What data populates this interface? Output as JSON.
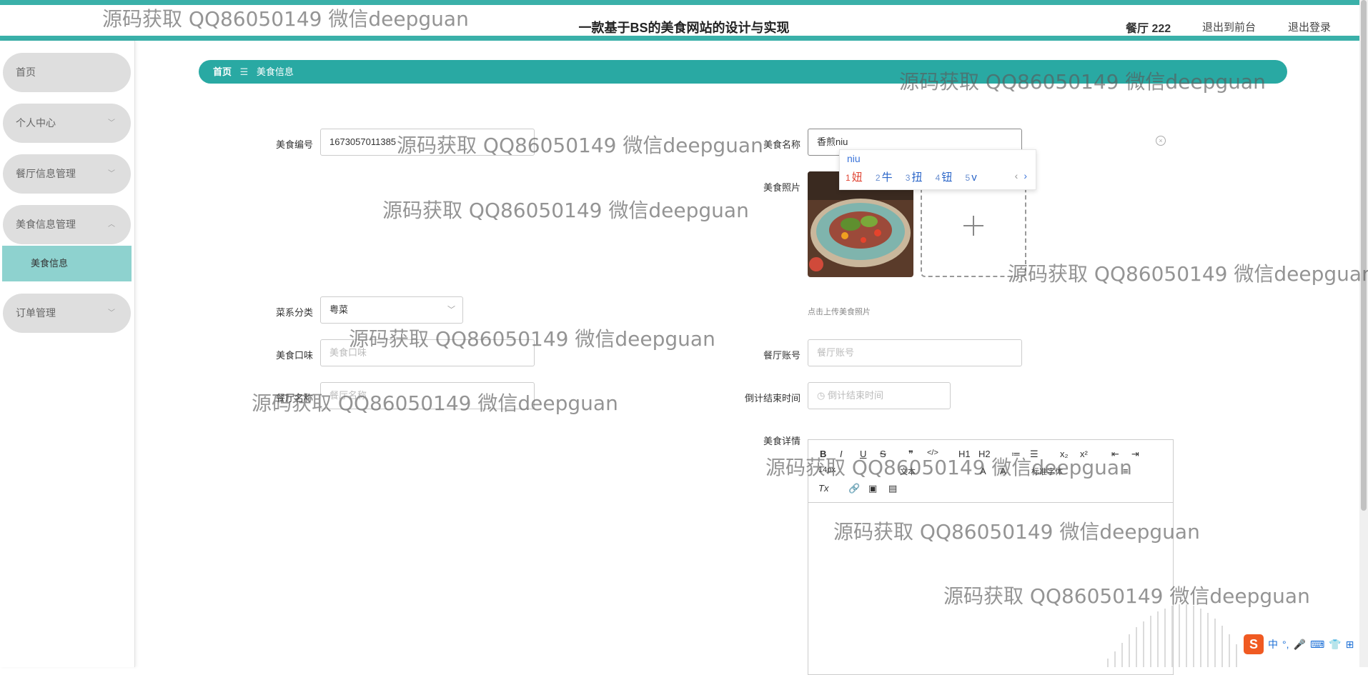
{
  "header": {
    "title": "一款基于BS的美食网站的设计与实现",
    "user": "餐厅 222",
    "link_front": "退出到前台",
    "link_logout": "退出登录"
  },
  "sidebar": {
    "items": [
      {
        "label": "首页"
      },
      {
        "label": "个人中心"
      },
      {
        "label": "餐厅信息管理"
      },
      {
        "label": "美食信息管理"
      },
      {
        "label": "订单管理"
      }
    ],
    "active_sub": "美食信息"
  },
  "breadcrumb": {
    "home": "首页",
    "sep": "☰",
    "current": "美食信息"
  },
  "form": {
    "food_no_label": "美食编号",
    "food_no_value": "1673057011385",
    "food_name_label": "美食名称",
    "food_name_value": "香煎niu",
    "photo_label": "美食照片",
    "upload_tip": "点击上传美食照片",
    "cuisine_label": "菜系分类",
    "cuisine_value": "粤菜",
    "taste_label": "美食口味",
    "taste_placeholder": "美食口味",
    "account_label": "餐厅账号",
    "account_placeholder": "餐厅账号",
    "restaurant_label": "餐厅名称",
    "restaurant_placeholder": "餐厅名称",
    "countdown_label": "倒计结束时间",
    "countdown_placeholder": "倒计结束时间",
    "detail_label": "美食详情"
  },
  "ime": {
    "composition": "niu",
    "candidates": [
      {
        "n": "1",
        "text": "妞"
      },
      {
        "n": "2",
        "text": "牛"
      },
      {
        "n": "3",
        "text": "扭"
      },
      {
        "n": "4",
        "text": "钮"
      },
      {
        "n": "5",
        "text": "v"
      }
    ]
  },
  "editor": {
    "row1": [
      "B",
      "I",
      "U",
      "S",
      "❞",
      "</>",
      "H1",
      "H2",
      "≔",
      "☰",
      "x₂",
      "x²",
      "⇤",
      "⇥"
    ],
    "row2": [
      "14px",
      "文本",
      "A",
      "A",
      "标准字体",
      "≡"
    ],
    "row3": [
      "Tx",
      "🔗",
      "▣",
      "▤"
    ]
  },
  "watermark": "源码获取 QQ86050149 微信deepguan",
  "tray": [
    "中",
    "°,",
    "🎤",
    "⌨",
    "👕",
    "⊞"
  ],
  "colors": {
    "teal": "#29a9a3",
    "light_teal": "#8ed2cf",
    "menu_gray": "#dedede"
  }
}
